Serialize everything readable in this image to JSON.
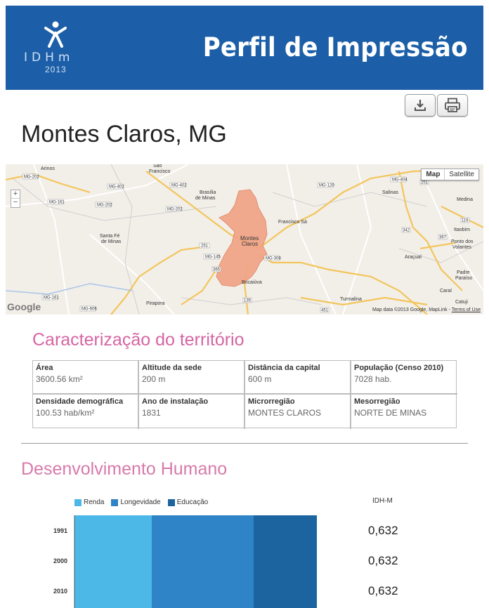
{
  "header": {
    "logo_text": "IDHm",
    "logo_year": "2013",
    "title": "Perfil de Impressão",
    "color": "#1c5fa8"
  },
  "actions": {
    "download_icon": "download-icon",
    "print_icon": "print-icon"
  },
  "page_title": "Montes Claros, MG",
  "map": {
    "toggle": [
      "Map",
      "Satellite"
    ],
    "zoom": [
      "+",
      "−"
    ],
    "google": "Google",
    "attribution": "Map data ©2013 Google, MapLink - ",
    "terms": "Terms of Use",
    "place_labels": [
      "Arinos",
      "São Francisco",
      "Brasília de Minas",
      "Santa Fé de Minas",
      "Montes Claros",
      "Francisco Sá",
      "Bocaiúva",
      "Pirapora",
      "Salinas",
      "Medina",
      "Itaobim",
      "Ponto dos Volantes",
      "Araçuaí",
      "Padre Paraíso",
      "Caraí",
      "Catuji",
      "Turmalina"
    ],
    "road_labels": [
      "MG-202",
      "MG-402",
      "MG-120",
      "MG-404",
      "MG-161",
      "MG-145",
      "MG-308",
      "MG-606",
      "251",
      "365",
      "135",
      "342",
      "367",
      "116",
      "251",
      "451"
    ]
  },
  "territory": {
    "title": "Caracterização do território",
    "cells": [
      {
        "label": "Área",
        "value": "3600.56 km²"
      },
      {
        "label": "Altitude da sede",
        "value": "200 m"
      },
      {
        "label": "Distância da capital",
        "value": "600 m"
      },
      {
        "label": "População (Censo 2010)",
        "value": "7028 hab."
      },
      {
        "label": "Densidade demográfica",
        "value": "100.53 hab/km²"
      },
      {
        "label": "Ano de instalação",
        "value": "1831"
      },
      {
        "label": "Microrregião",
        "value": "MONTES CLAROS"
      },
      {
        "label": "Mesorregião",
        "value": "NORTE DE MINAS"
      }
    ]
  },
  "human_dev": {
    "title": "Desenvolvimento Humano",
    "idhm_header": "IDH-M"
  },
  "chart_data": {
    "type": "bar",
    "orientation": "horizontal-stacked",
    "categories": [
      "1991",
      "2000",
      "2010"
    ],
    "series": [
      {
        "name": "Renda",
        "color": "#4cb8e8"
      },
      {
        "name": "Longevidade",
        "color": "#2e84c6"
      },
      {
        "name": "Educação",
        "color": "#1c64a0"
      }
    ],
    "idhm_values": [
      "0,632",
      "0,632",
      "0,632"
    ]
  }
}
